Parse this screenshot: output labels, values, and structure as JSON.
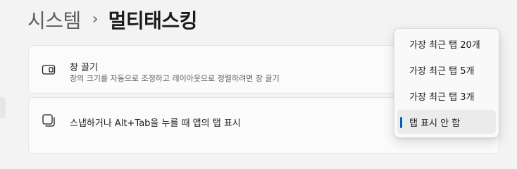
{
  "breadcrumb": {
    "parent": "시스템",
    "separator": "›",
    "current": "멀티태스킹"
  },
  "settings": [
    {
      "title": "창 끌기",
      "description": "창의 크기를 자동으로 조정하고 레이아웃으로 정렬하려면 창 끌기",
      "icon": "snap-window-icon"
    },
    {
      "title": "스냅하거나 Alt+Tab을 누를 때 앱의 탭 표시",
      "icon": "stacked-windows-icon"
    }
  ],
  "dropdown": {
    "options": [
      {
        "label": "가장 최근 탭 20개",
        "selected": false
      },
      {
        "label": "가장 최근 탭 5개",
        "selected": false
      },
      {
        "label": "가장 최근 탭 3개",
        "selected": false
      },
      {
        "label": "탭 표시 안 함",
        "selected": true
      }
    ]
  },
  "colors": {
    "accent": "#005fb8",
    "background": "#f3f3f3",
    "card": "#fbfbfb"
  }
}
